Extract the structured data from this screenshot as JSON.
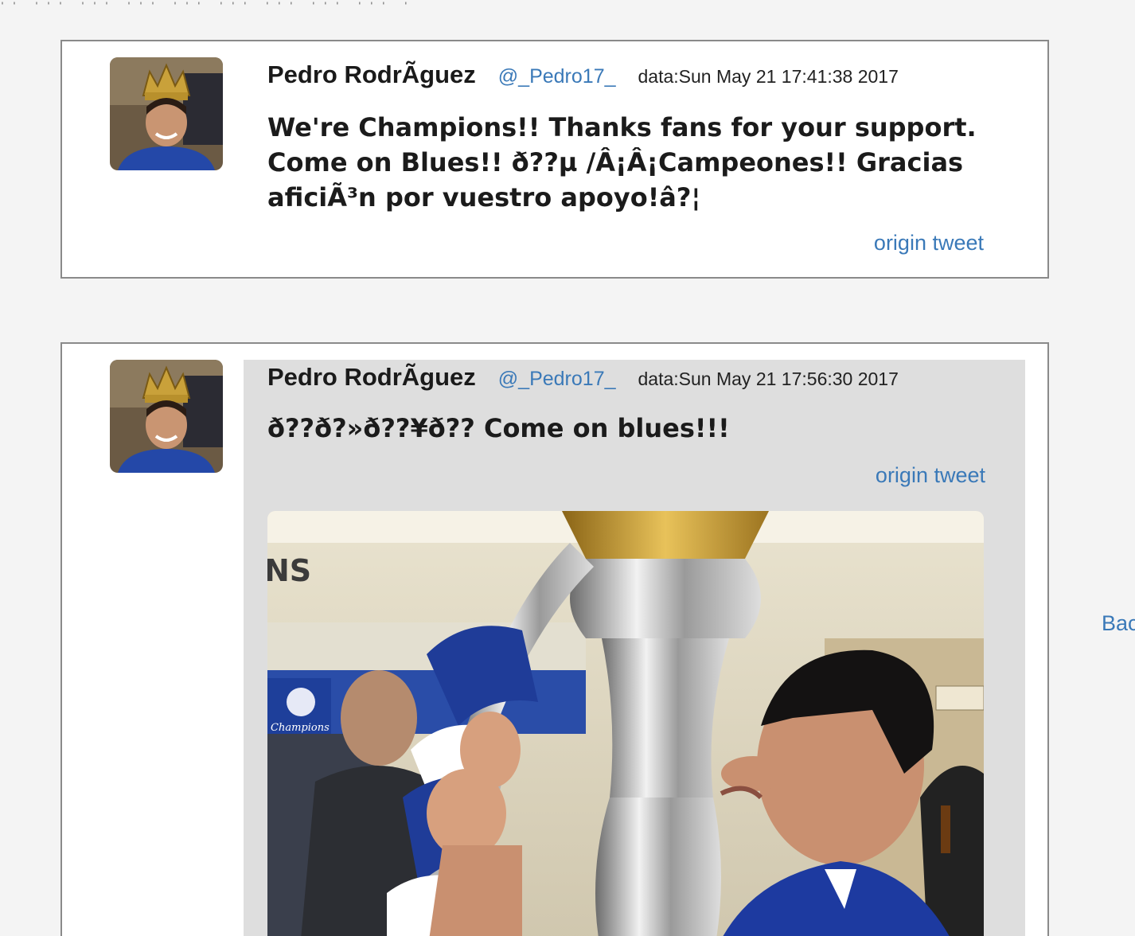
{
  "tweets": [
    {
      "user_name": "Pedro RodrÃguez",
      "handle": "@_Pedro17_",
      "date": "data:Sun May 21 17:41:38 2017",
      "text": "We're Champions!! Thanks fans for your support. Come on Blues!! ð??µ /Â¡Â¡Campeones!! Gracias aficiÃ³n por vuestro apoyo!â?¦",
      "origin_label": "origin tweet"
    },
    {
      "user_name": "Pedro RodrÃguez",
      "handle": "@_Pedro17_",
      "date": "data:Sun May 21 17:56:30 2017",
      "text": "ð??ð?»ð??¥ð?? Come on blues!!!",
      "origin_label": "origin tweet",
      "photo_sign": "NS",
      "photo_banner": "Champions"
    }
  ],
  "back_label": "Bac",
  "colors": {
    "link": "#3a79b8",
    "highlight_bg": "#dedede",
    "card_border": "#8a8a8a",
    "page_bg": "#f4f4f4"
  }
}
